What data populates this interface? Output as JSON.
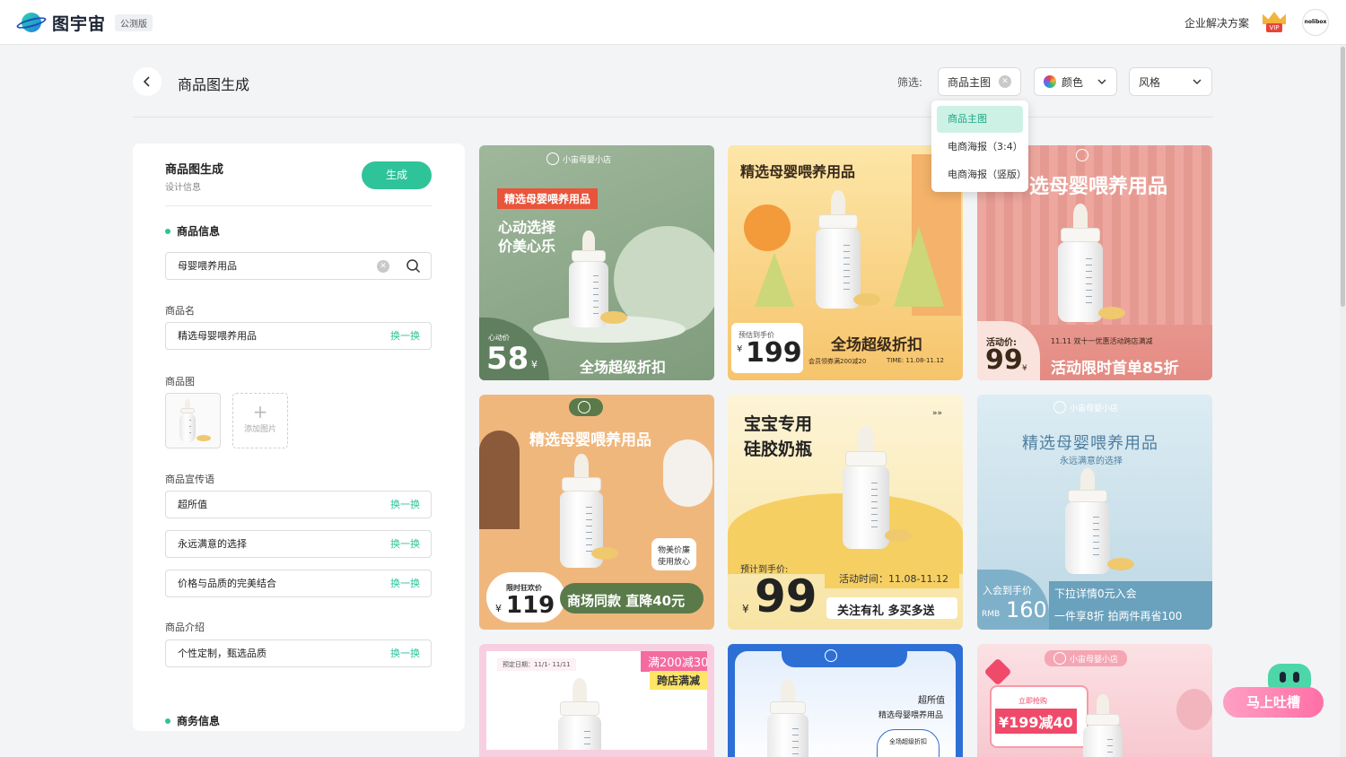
{
  "topbar": {
    "app_name": "图宇宙",
    "beta_badge": "公测版",
    "enterprise_link": "企业解决方案",
    "vip_label": "VIP",
    "avatar_text": "nolibox"
  },
  "page": {
    "title": "商品图生成",
    "filter_label": "筛选:",
    "filters": {
      "main": "商品主图",
      "color": "颜色",
      "style": "风格"
    },
    "dropdown_options": [
      "商品主图",
      "电商海报（3:4）",
      "电商海报（竖版）"
    ]
  },
  "panel": {
    "title": "商品图生成",
    "subtitle": "设计信息",
    "generate_button": "生成",
    "section_product": "商品信息",
    "search_value": "母婴喂养用品",
    "name_label": "商品名",
    "name_value": "精选母婴喂养用品",
    "swap_label": "换一换",
    "image_label": "商品图",
    "add_image_label": "添加图片",
    "slogan_label": "商品宣传语",
    "slogans": [
      "超所值",
      "永远满意的选择",
      "价格与品质的完美结合"
    ],
    "intro_label": "商品介绍",
    "intro_value": "个性定制，甄选品质",
    "section_business": "商务信息"
  },
  "cards": {
    "c1": {
      "brand": "小宙母婴小店",
      "tag": "精选母婴喂养用品",
      "slogan1": "心动选择",
      "slogan2": "价美心乐",
      "price_label": "心动价",
      "price": "58",
      "currency": "¥",
      "promo": "全场超级折扣"
    },
    "c2": {
      "title": "精选母婴喂养用品",
      "price_label": "预估到手价",
      "currency": "¥",
      "price": "199",
      "promo": "全场超级折扣",
      "note": "会员领券满200减20",
      "time": "TIME: 11.08-11.12"
    },
    "c3": {
      "title": "选母婴喂养用品",
      "price_label": "活动价:",
      "price": "99",
      "currency": "¥",
      "event": "11.11 双十一优惠活动跨店满减",
      "promo": "活动限时首单85折"
    },
    "c4": {
      "title": "精选母婴喂养用品",
      "bubble1": "物美价廉",
      "bubble2": "使用放心",
      "price_label": "限时狂欢价",
      "currency": "¥",
      "price": "119",
      "promo": "商场同款 直降40元"
    },
    "c5": {
      "title1": "宝宝专用",
      "title2": "硅胶奶瓶",
      "price_label": "预计到手价:",
      "currency": "¥",
      "price": "99",
      "time": "活动时间：11.08-11.12",
      "promo": "关注有礼 多买多送"
    },
    "c6": {
      "brand": "小宙母婴小店",
      "title": "精选母婴喂养用品",
      "subtitle": "永远满意的选择",
      "price_label": "入会到手价",
      "rmb": "RMB",
      "price": "160",
      "promo1": "下拉详情0元入会",
      "promo2": "一件享8折 拍两件再省100"
    },
    "c7": {
      "date": "预定日期：11/1- 11/11",
      "tag1": "满200减30",
      "tag2": "跨店满减"
    },
    "c8": {
      "text1": "超所值",
      "text2": "精选母婴喂养用品",
      "badge": "全场超级折扣"
    },
    "c9": {
      "brand": "小宙母婴小店",
      "price_label": "立即抢购",
      "price": "¥199减40"
    }
  },
  "feedback": {
    "label": "马上吐槽"
  },
  "colors": {
    "accent": "#2fc39a",
    "dropdown_active_bg": "#cdf2e5"
  }
}
